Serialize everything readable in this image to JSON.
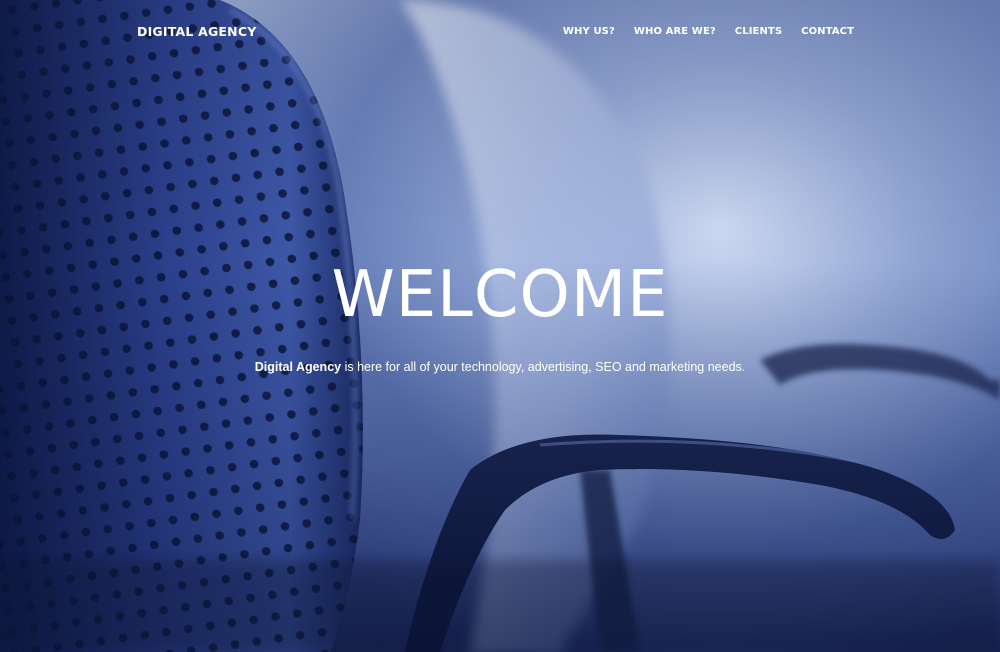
{
  "header": {
    "logo": "DIGITAL AGENCY",
    "nav": [
      {
        "label": "WHY US?"
      },
      {
        "label": "WHO ARE WE?"
      },
      {
        "label": "CLIENTS"
      },
      {
        "label": "CONTACT"
      }
    ]
  },
  "hero": {
    "title": "WELCOME",
    "subtitle_brand": "Digital Agency",
    "subtitle_rest": " is here for all of your technology, advertising, SEO and marketing needs.",
    "background": "office-chairs-photo"
  },
  "colors": {
    "text": "#ffffff",
    "background_dark": "#1c2a5c",
    "background_light": "#c8d4ee"
  }
}
